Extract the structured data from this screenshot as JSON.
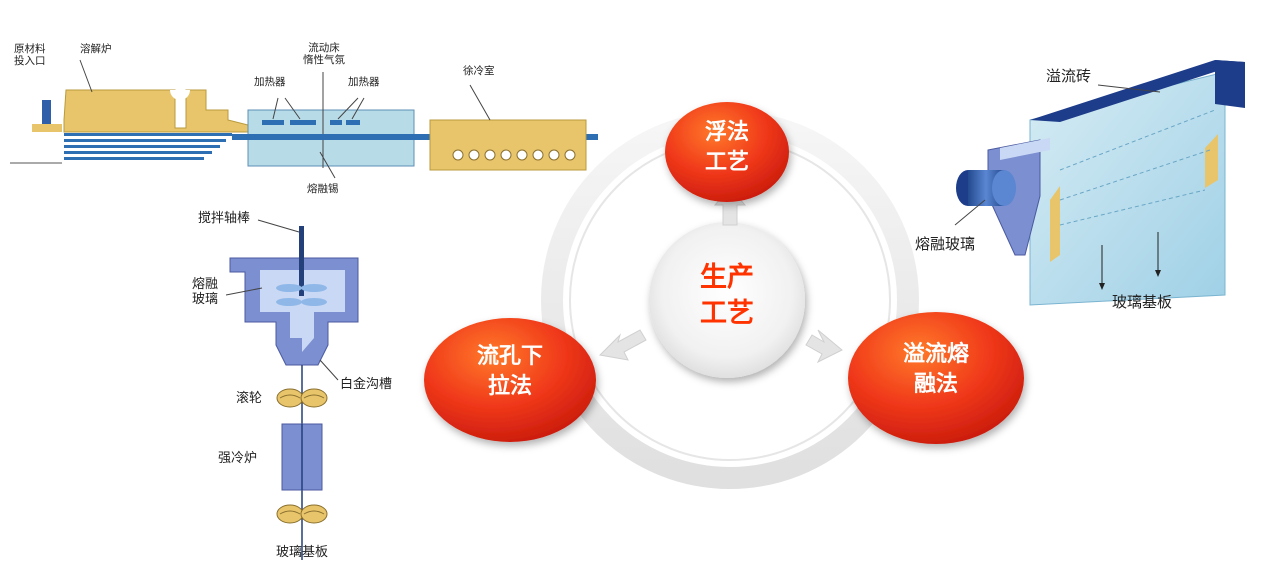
{
  "float_diagram": {
    "raw_material_inlet": [
      "原材料",
      "投入口"
    ],
    "melting_furnace": "溶解炉",
    "fluid_bed": [
      "流动床",
      "惰性气氛"
    ],
    "heater": "加热器",
    "annealing": "徐冷室",
    "molten_tin": "熔融锡"
  },
  "downdraw_diagram": {
    "stir_rod": "搅拌轴棒",
    "molten_glass": [
      "熔融",
      "玻璃"
    ],
    "platinum_trough": "白金沟槽",
    "roller": "滚轮",
    "cooling_furnace": "强冷炉",
    "substrate": "玻璃基板"
  },
  "fusion_diagram": {
    "overflow_brick": "溢流砖",
    "molten_glass": "熔融玻璃",
    "substrate": "玻璃基板"
  },
  "center": {
    "label": [
      "生产",
      "工艺"
    ]
  },
  "methods": {
    "float": [
      "浮法",
      "工艺"
    ],
    "downdraw": [
      "流孔下",
      "拉法"
    ],
    "fusion": [
      "溢流熔",
      "融法"
    ]
  },
  "colors": {
    "furnace_yellow": "#e8c56a",
    "tin_blue": "#2e6fb4",
    "chamber_blue": "#b8dbe8",
    "device_blue": "#7b8fd1",
    "red_circle": "#f0381a",
    "center_text": "#ff3300"
  }
}
